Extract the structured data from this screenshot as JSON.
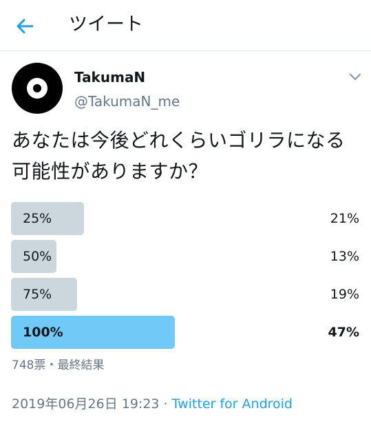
{
  "header": {
    "back_icon": "arrow-left-icon",
    "title": "ツイート"
  },
  "tweet": {
    "avatar_icon": "vinyl-record-avatar",
    "display_name": "TakumaN",
    "handle": "@TakumaN_me",
    "menu_icon": "chevron-down-icon",
    "text": "あなたは今後どれくらいゴリラになる可能性がありますか？"
  },
  "poll": {
    "options": [
      {
        "label": "25%",
        "percent": "21%",
        "share": 21,
        "winner": false
      },
      {
        "label": "50%",
        "percent": "13%",
        "share": 13,
        "winner": false
      },
      {
        "label": "75%",
        "percent": "19%",
        "share": 19,
        "winner": false
      },
      {
        "label": "100%",
        "percent": "47%",
        "share": 47,
        "winner": true
      }
    ],
    "meta": "748票・最終結果"
  },
  "footer": {
    "date": "2019年06月26日 19:23",
    "separator": " · ",
    "source": "Twitter for Android"
  },
  "colors": {
    "accent": "#1da1f2",
    "winner_bar": "#71c9f8",
    "bar": "#ccd6dd",
    "muted_text": "#657786"
  }
}
